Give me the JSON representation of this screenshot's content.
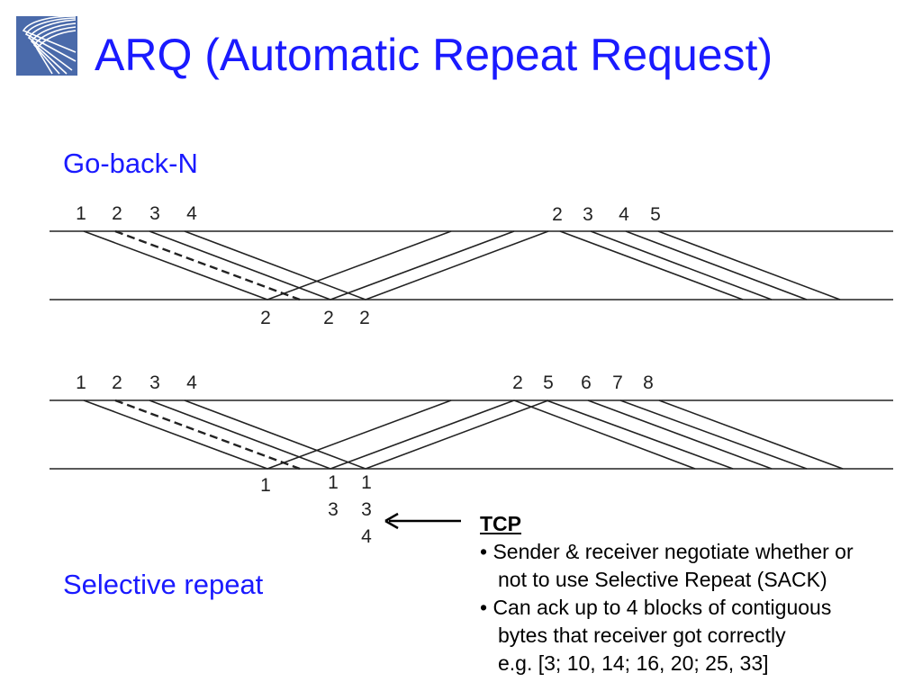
{
  "title": "ARQ (Automatic Repeat Request)",
  "logo": {
    "icon": "curved-lines-logo",
    "color": "#4a6aaa"
  },
  "accent_color": "#1a1aff",
  "go_back_n": {
    "heading": "Go-back-N",
    "sender_labels": [
      "1",
      "2",
      "3",
      "4",
      "2",
      "3",
      "4",
      "5"
    ],
    "receiver_labels": [
      "2",
      "2",
      "2"
    ]
  },
  "selective_repeat": {
    "heading": "Selective repeat",
    "sender_labels": [
      "1",
      "2",
      "3",
      "4",
      "2",
      "5",
      "6",
      "7",
      "8"
    ],
    "receiver_labels": [
      "1",
      "1",
      "3",
      "1",
      "3",
      "4"
    ]
  },
  "tcp_note": {
    "heading": "TCP",
    "bullets": [
      {
        "line1": "• Sender & receiver negotiate whether or",
        "line2": "not to use Selective Repeat (SACK)"
      },
      {
        "line1": "• Can ack up to 4 blocks of contiguous",
        "line2": "bytes that receiver got correctly"
      }
    ],
    "example": "e.g. [3; 10, 14; 16, 20; 25, 33]"
  }
}
